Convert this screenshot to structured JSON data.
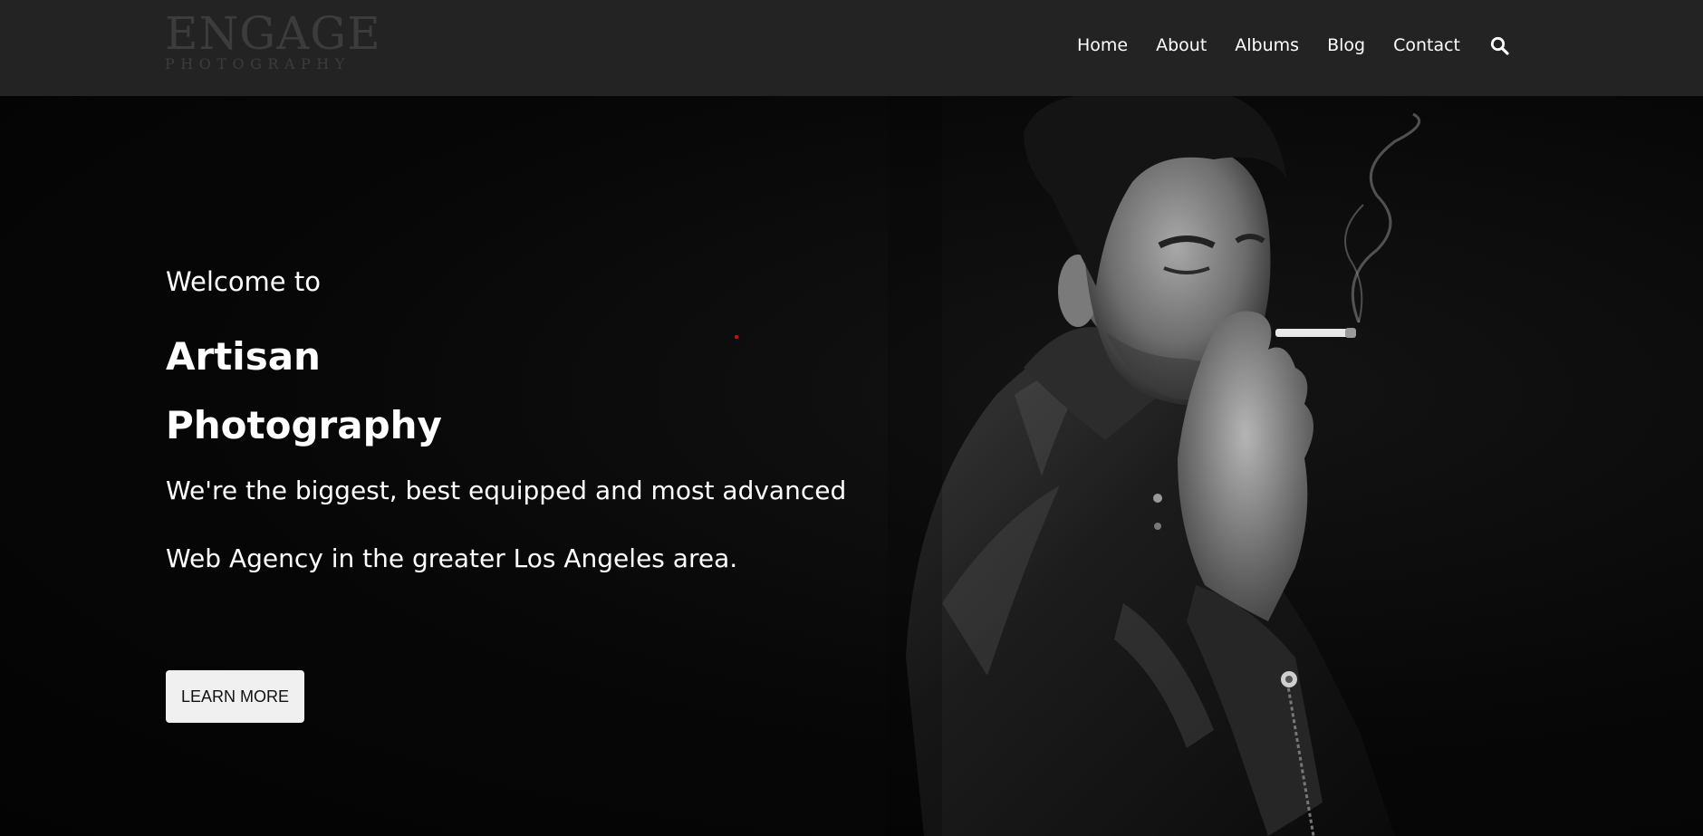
{
  "logo": {
    "main": "ENGAGE",
    "sub": "PHOTOGRAPHY"
  },
  "nav": {
    "items": [
      {
        "label": "Home"
      },
      {
        "label": "About"
      },
      {
        "label": "Albums"
      },
      {
        "label": "Blog"
      },
      {
        "label": "Contact"
      }
    ],
    "search_icon": "search-icon"
  },
  "hero": {
    "welcome": "Welcome to",
    "title": "Artisan Photography",
    "description": "We're the biggest, best equipped and most advanced Web Agency in the greater Los Angeles area.",
    "button_label": "LEARN MORE",
    "photo": "black-and-white portrait of man in leather jacket smoking"
  },
  "colors": {
    "header_bg": "#232323",
    "hero_bg": "#050505",
    "logo": "#3c3c3c",
    "button_bg": "#f0f0f0",
    "text": "#ffffff"
  }
}
